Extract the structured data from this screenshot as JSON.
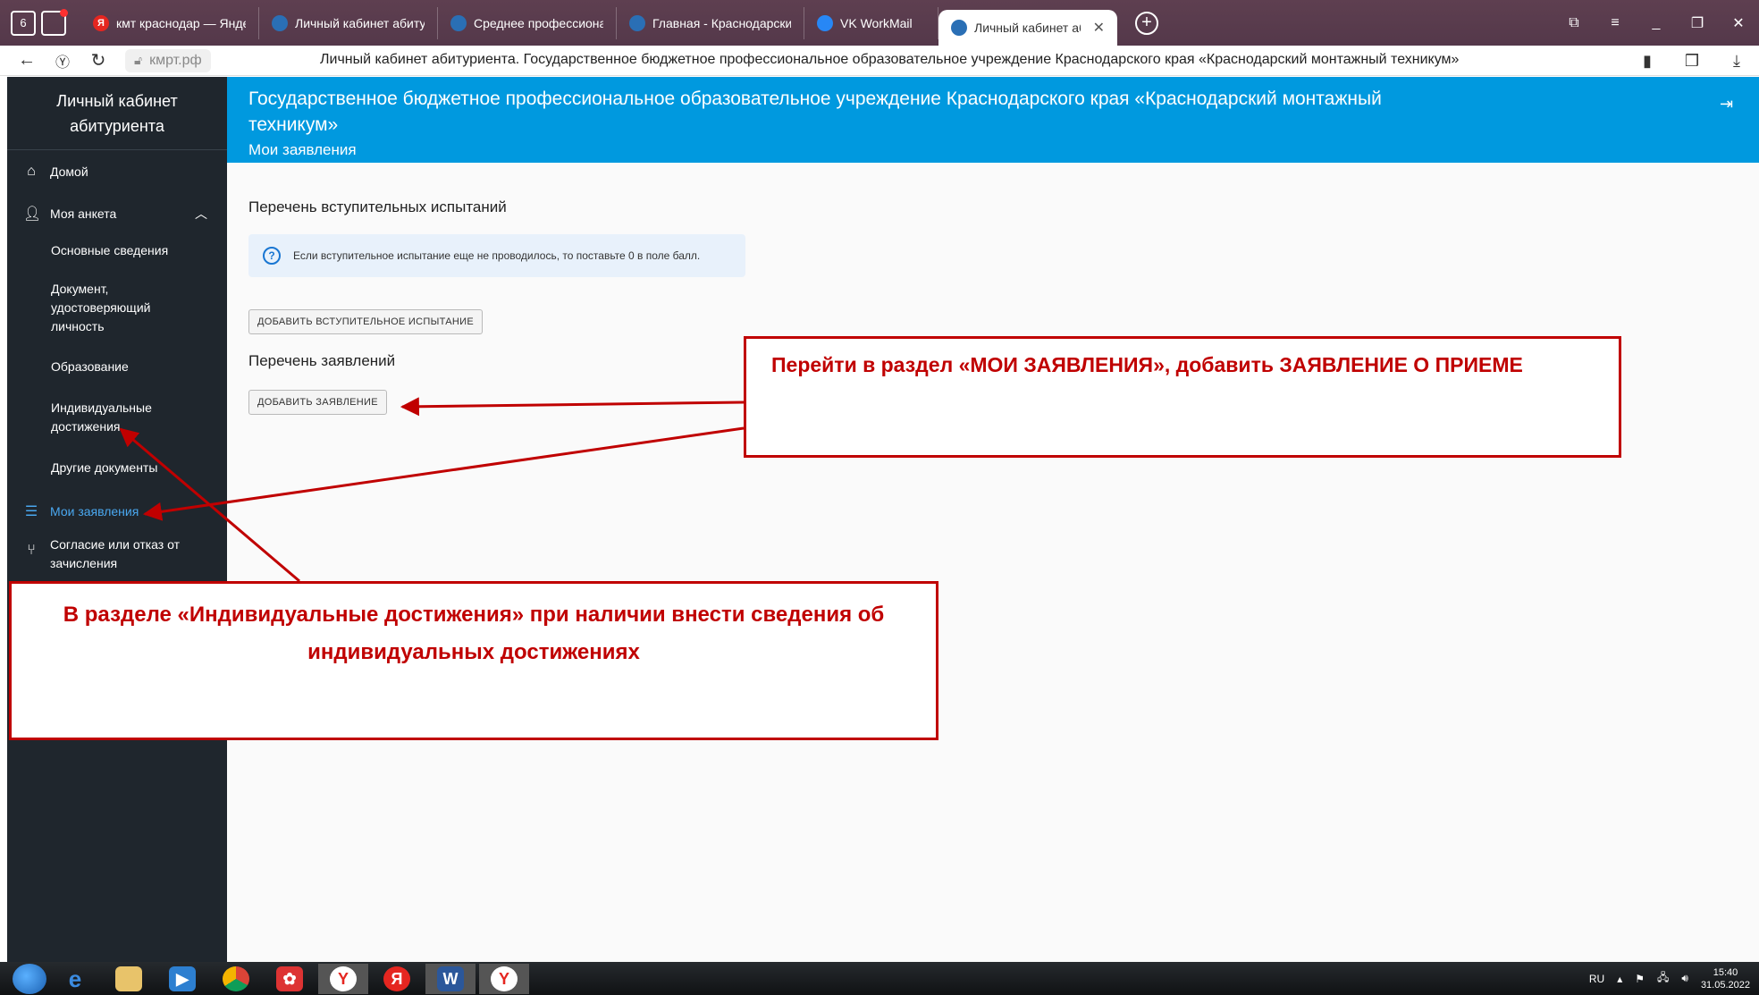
{
  "browser": {
    "tabs": [
      {
        "label": "кмт краснодар — Яндекс",
        "fav_color": "#e52620",
        "fav_char": "Я"
      },
      {
        "label": "Личный кабинет абитури",
        "fav_color": "#2a6fb5",
        "fav_char": ""
      },
      {
        "label": "Среднее профессиональ",
        "fav_color": "#2a6fb5",
        "fav_char": ""
      },
      {
        "label": "Главная - Краснодарский",
        "fav_color": "#2a6fb5",
        "fav_char": ""
      },
      {
        "label": "VK WorkMail",
        "fav_color": "#2787f5",
        "fav_char": ""
      },
      {
        "label": "Личный кабинет абиту",
        "fav_color": "#2a6fb5",
        "fav_char": "",
        "active": true
      }
    ],
    "tab_badge": "6",
    "domain": "кмрт.рф",
    "page_title": "Личный кабинет абитуриента. Государственное бюджетное профессиональное образовательное учреждение Краснодарского края «Краснодарский монтажный техникум»"
  },
  "sidebar": {
    "title": "Личный кабинет абитуриента",
    "items": {
      "home": "Домой",
      "profile": "Моя анкета",
      "basic_info": "Основные сведения",
      "id_document": "Документ, удостоверяющий личность",
      "education": "Образование",
      "achievements": "Индивидуальные достижения",
      "other_docs": "Другие документы",
      "my_applications": "Мои заявления",
      "consent": "Согласие или отказ от зачисления"
    },
    "active_color": "#4aa8f0"
  },
  "header": {
    "title": "Государственное бюджетное профессиональное образовательное учреждение Краснодарского края «Краснодарский монтажный техникум»",
    "subtitle": "Мои заявления",
    "color": "#0099df"
  },
  "main": {
    "exams_title": "Перечень вступительных испытаний",
    "info_text": "Если вступительное испытание еще не проводилось, то поставьте 0 в поле балл.",
    "add_exam_button": "ДОБАВИТЬ ВСТУПИТЕЛЬНОЕ ИСПЫТАНИЕ",
    "applications_title": "Перечень заявлений",
    "add_application_button": "ДОБАВИТЬ ЗАЯВЛЕНИЕ"
  },
  "annotations": {
    "callout_top": "Перейти в раздел «МОИ ЗАЯВЛЕНИЯ», добавить ЗАЯВЛЕНИЕ О ПРИЕМЕ",
    "callout_bottom": "В разделе «Индивидуальные достижения»  при наличии внести сведения об индивидуальных достижениях",
    "color": "#c00000"
  },
  "taskbar": {
    "language": "RU",
    "time": "15:40",
    "date": "31.05.2022"
  }
}
